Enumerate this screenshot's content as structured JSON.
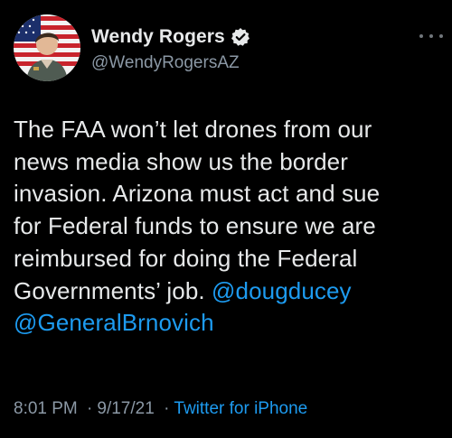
{
  "author": {
    "display_name": "Wendy Rogers",
    "handle": "@WendyRogersAZ",
    "verified": true
  },
  "tweet": {
    "lines": [
      "The FAA won’t let drones from our",
      "news media show us the border",
      "invasion. Arizona must act and sue",
      "for Federal funds to ensure we are",
      "reimbursed for doing the Federal",
      "Governments’ job. "
    ],
    "mention_1": "@dougducey",
    "mention_2": "@GeneralBrnovich"
  },
  "meta": {
    "time": "8:01 PM",
    "date": "9/17/21",
    "separator": "·",
    "source": "Twitter for iPhone"
  },
  "colors": {
    "background": "#000000",
    "text": "#e7e9ea",
    "secondary": "#8b98a5",
    "link": "#1d9bf0"
  }
}
